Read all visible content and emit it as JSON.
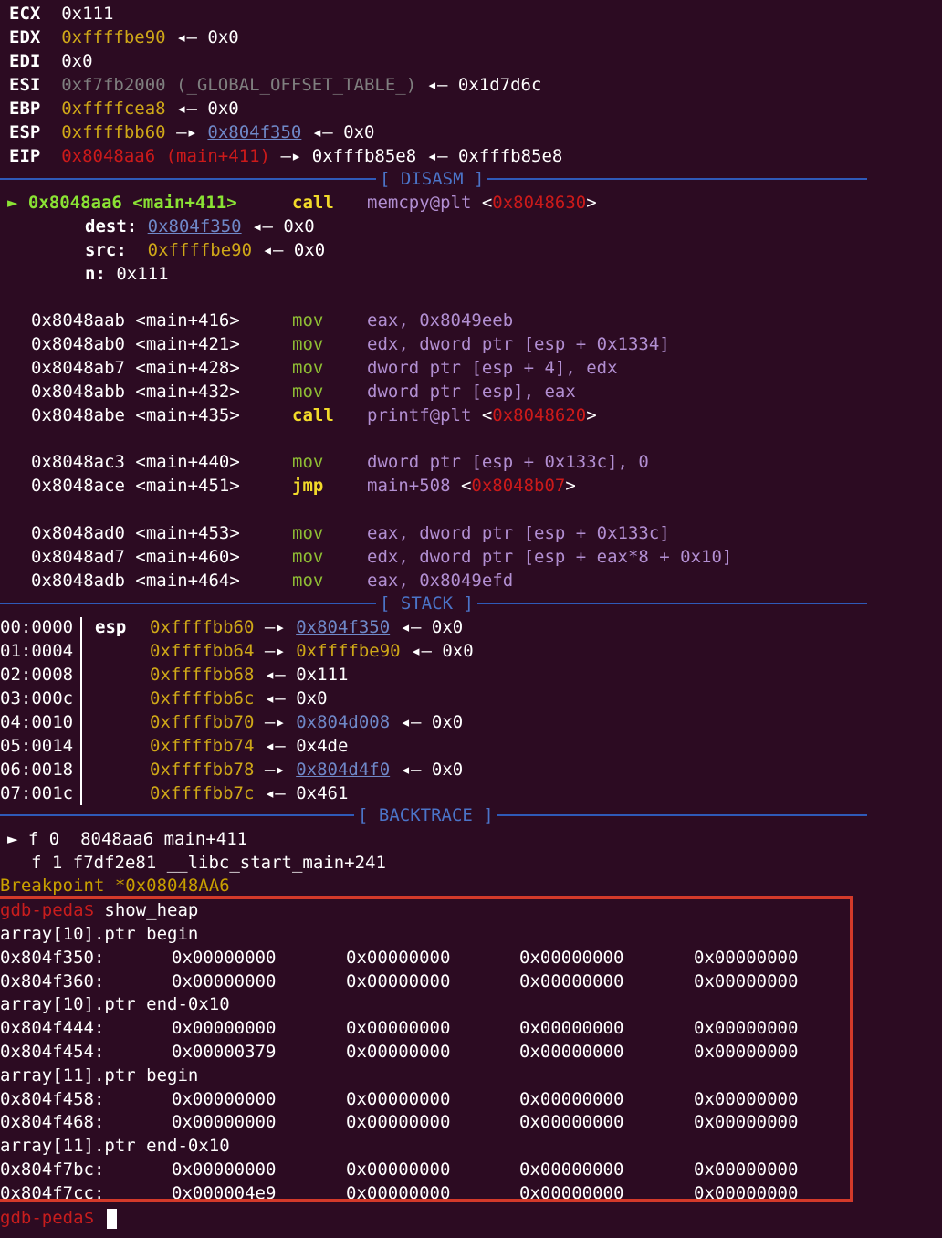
{
  "registers": [
    {
      "name": "ECX",
      "value": "0x111"
    },
    {
      "name": "EDX",
      "value": "0xffffbe90",
      "tail": "◂— 0x0"
    },
    {
      "name": "EDI",
      "value": "0x0"
    },
    {
      "name": "ESI",
      "value": "0xf7fb2000 (_GLOBAL_OFFSET_TABLE_)",
      "tail": "◂— 0x1d7d6c"
    },
    {
      "name": "EBP",
      "value": "0xffffcea8",
      "tail": "◂— 0x0"
    },
    {
      "name": "ESP",
      "value": "0xffffbb60",
      "arrow": "—▸",
      "link": "0x804f350",
      "tail": "◂— 0x0"
    },
    {
      "name": "EIP",
      "value": "0x8048aa6 (main+411)",
      "arrow": "—▸",
      "tail": "0xfffb85e8 ◂— 0xfffb85e8"
    }
  ],
  "sections": {
    "disasm": "[ DISASM ]",
    "stack": "[ STACK ]",
    "backtrace": "[ BACKTRACE ]"
  },
  "disasm": {
    "current": {
      "marker": "►",
      "addr": "0x8048aa6 <main+411>",
      "op": "call",
      "arg": "memcpy@plt",
      "target": "0x8048630"
    },
    "args": [
      {
        "label": "dest:",
        "link": "0x804f350",
        "tail": "◂— 0x0"
      },
      {
        "label": "src:",
        "value": "0xffffbe90",
        "tail": "◂— 0x0"
      },
      {
        "label": "n:",
        "value": "0x111"
      }
    ],
    "lines": [
      {
        "addr": "0x8048aab <main+416>",
        "op": "mov",
        "args": "eax, 0x8049eeb"
      },
      {
        "addr": "0x8048ab0 <main+421>",
        "op": "mov",
        "args": "edx, dword ptr [esp + 0x1334]"
      },
      {
        "addr": "0x8048ab7 <main+428>",
        "op": "mov",
        "args": "dword ptr [esp + 4], edx"
      },
      {
        "addr": "0x8048abb <main+432>",
        "op": "mov",
        "args": "dword ptr [esp], eax"
      },
      {
        "addr": "0x8048abe <main+435>",
        "op": "call",
        "args": "printf@plt",
        "target": "0x8048620"
      },
      {
        "addr": "0x8048ac3 <main+440>",
        "op": "mov",
        "args": "dword ptr [esp + 0x133c], 0"
      },
      {
        "addr": "0x8048ace <main+451>",
        "op": "jmp",
        "args": "main+508",
        "target": "0x8048b07"
      },
      {
        "addr": "0x8048ad0 <main+453>",
        "op": "mov",
        "args": "eax, dword ptr [esp + 0x133c]"
      },
      {
        "addr": "0x8048ad7 <main+460>",
        "op": "mov",
        "args": "edx, dword ptr [esp + eax*8 + 0x10]"
      },
      {
        "addr": "0x8048adb <main+464>",
        "op": "mov",
        "args": "eax, 0x8049efd"
      }
    ]
  },
  "stack": [
    {
      "idx": "00:0000",
      "reg": "esp",
      "addr": "0xffffbb60",
      "arrow": "—▸",
      "val": "0x804f350",
      "link": true,
      "tail": "◂— 0x0"
    },
    {
      "idx": "01:0004",
      "reg": "",
      "addr": "0xffffbb64",
      "arrow": "—▸",
      "val": "0xffffbe90",
      "yellow": true,
      "tail": "◂— 0x0"
    },
    {
      "idx": "02:0008",
      "reg": "",
      "addr": "0xffffbb68",
      "arrow": "◂—",
      "val": "0x111"
    },
    {
      "idx": "03:000c",
      "reg": "",
      "addr": "0xffffbb6c",
      "arrow": "◂—",
      "val": "0x0"
    },
    {
      "idx": "04:0010",
      "reg": "",
      "addr": "0xffffbb70",
      "arrow": "—▸",
      "val": "0x804d008",
      "link": true,
      "tail": "◂— 0x0"
    },
    {
      "idx": "05:0014",
      "reg": "",
      "addr": "0xffffbb74",
      "arrow": "◂—",
      "val": "0x4de"
    },
    {
      "idx": "06:0018",
      "reg": "",
      "addr": "0xffffbb78",
      "arrow": "—▸",
      "val": "0x804d4f0",
      "link": true,
      "tail": "◂— 0x0"
    },
    {
      "idx": "07:001c",
      "reg": "",
      "addr": "0xffffbb7c",
      "arrow": "◂—",
      "val": "0x461"
    }
  ],
  "backtrace": [
    {
      "marker": "►",
      "text": "f 0  8048aa6 main+411"
    },
    {
      "marker": "",
      "text": "f 1 f7df2e81 __libc_start_main+241"
    }
  ],
  "breakpoint": "Breakpoint *0x08048AA6",
  "prompt": "gdb-peda$",
  "command": "show_heap",
  "heap": [
    {
      "type": "label",
      "text": "array[10].ptr begin"
    },
    {
      "type": "row",
      "addr": "0x804f350:",
      "w": [
        "0x00000000",
        "0x00000000",
        "0x00000000",
        "0x00000000"
      ]
    },
    {
      "type": "row",
      "addr": "0x804f360:",
      "w": [
        "0x00000000",
        "0x00000000",
        "0x00000000",
        "0x00000000"
      ]
    },
    {
      "type": "label",
      "text": "array[10].ptr end-0x10"
    },
    {
      "type": "row",
      "addr": "0x804f444:",
      "w": [
        "0x00000000",
        "0x00000000",
        "0x00000000",
        "0x00000000"
      ]
    },
    {
      "type": "row",
      "addr": "0x804f454:",
      "w": [
        "0x00000379",
        "0x00000000",
        "0x00000000",
        "0x00000000"
      ]
    },
    {
      "type": "label",
      "text": "array[11].ptr begin"
    },
    {
      "type": "row",
      "addr": "0x804f458:",
      "w": [
        "0x00000000",
        "0x00000000",
        "0x00000000",
        "0x00000000"
      ]
    },
    {
      "type": "row",
      "addr": "0x804f468:",
      "w": [
        "0x00000000",
        "0x00000000",
        "0x00000000",
        "0x00000000"
      ]
    },
    {
      "type": "label",
      "text": "array[11].ptr end-0x10"
    },
    {
      "type": "row",
      "addr": "0x804f7bc:",
      "w": [
        "0x00000000",
        "0x00000000",
        "0x00000000",
        "0x00000000"
      ]
    },
    {
      "type": "row",
      "addr": "0x804f7cc:",
      "w": [
        "0x000004e9",
        "0x00000000",
        "0x00000000",
        "0x00000000"
      ]
    }
  ]
}
